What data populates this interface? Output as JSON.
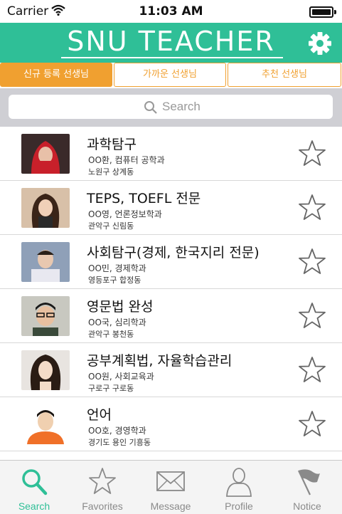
{
  "status_bar": {
    "carrier": "Carrier",
    "time": "11:03 AM"
  },
  "header": {
    "title": "SNU TEACHER",
    "settings_icon": "gear-icon"
  },
  "segments": [
    {
      "label": "신규 등록 선생님",
      "active": true
    },
    {
      "label": "가까운 선생님",
      "active": false
    },
    {
      "label": "추천 선생님",
      "active": false
    }
  ],
  "search": {
    "placeholder": "Search"
  },
  "teachers": [
    {
      "subject": "과학탐구",
      "info": "OO환, 컴퓨터 공학과",
      "location": "노원구 상계동"
    },
    {
      "subject": "TEPS, TOEFL 전문",
      "info": "OO영, 언론정보학과",
      "location": "관악구 신림동"
    },
    {
      "subject": "사회탐구(경제, 한국지리 전문)",
      "info": "OO민, 경제학과",
      "location": "영등포구 합정동"
    },
    {
      "subject": "영문법 완성",
      "info": "OO국, 심리학과",
      "location": "관악구 봉천동"
    },
    {
      "subject": "공부계획법, 자율학습관리",
      "info": "OO원, 사회교육과",
      "location": "구로구 구로동"
    },
    {
      "subject": "언어",
      "info": "OO호, 경영학과",
      "location": "경기도 용인 기흥동"
    }
  ],
  "tabs": [
    {
      "label": "Search",
      "icon": "search-icon",
      "active": true
    },
    {
      "label": "Favorites",
      "icon": "star-icon",
      "active": false
    },
    {
      "label": "Message",
      "icon": "envelope-icon",
      "active": false
    },
    {
      "label": "Profile",
      "icon": "person-icon",
      "active": false
    },
    {
      "label": "Notice",
      "icon": "flag-icon",
      "active": false
    }
  ],
  "colors": {
    "accent": "#2fbf97",
    "segment": "#f0a030",
    "inactive_tab": "#8a8a8a"
  }
}
